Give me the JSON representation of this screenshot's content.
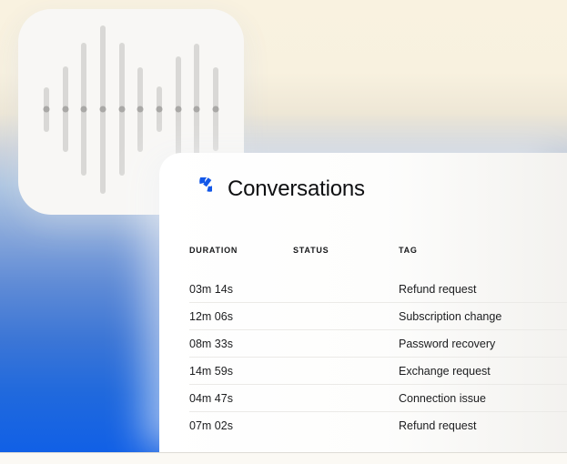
{
  "card": {
    "title": "Conversations",
    "logo_icon": "conversations-c-mark",
    "logo_color": "#1257e8"
  },
  "waveform": {
    "bar_heights": [
      49,
      94,
      146,
      185,
      146,
      93,
      50,
      116,
      144,
      92
    ],
    "bar_color": "#d9d8d6",
    "dot_color": "#a9a8a6"
  },
  "table": {
    "headers": [
      "DURATION",
      "STATUS",
      "TAG"
    ],
    "rows": [
      {
        "duration": "03m 14s",
        "status": "",
        "tag": "Refund request"
      },
      {
        "duration": "12m 06s",
        "status": "",
        "tag": "Subscription change"
      },
      {
        "duration": "08m 33s",
        "status": "",
        "tag": "Password recovery"
      },
      {
        "duration": "14m 59s",
        "status": "",
        "tag": "Exchange request"
      },
      {
        "duration": "04m 47s",
        "status": "",
        "tag": "Connection issue"
      },
      {
        "duration": "07m 02s",
        "status": "",
        "tag": "Refund request"
      }
    ]
  },
  "colors": {
    "gradient_top": "#f9f2e0",
    "gradient_bottom": "#1160e6",
    "accent_blue": "#1257e8"
  }
}
